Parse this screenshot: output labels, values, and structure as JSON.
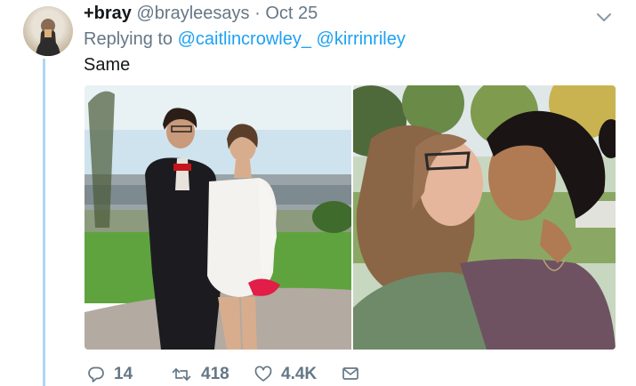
{
  "tweet": {
    "display_name": "+bray",
    "handle": "@brayleesays",
    "separator": "·",
    "date": "Oct 25",
    "replying_prefix": "Replying to",
    "mentions": [
      "@caitlincrowley_",
      "@kirrinriley"
    ],
    "text": "Same"
  },
  "icons": {
    "menu": "chevron-down-icon",
    "reply": "reply-icon",
    "retweet": "retweet-icon",
    "like": "heart-icon",
    "dm": "envelope-icon"
  },
  "actions": {
    "reply_count": "14",
    "retweet_count": "418",
    "like_count": "4.4K"
  },
  "colors": {
    "link": "#1da1f2",
    "muted": "#657786",
    "thread_line": "#aed6f5"
  }
}
